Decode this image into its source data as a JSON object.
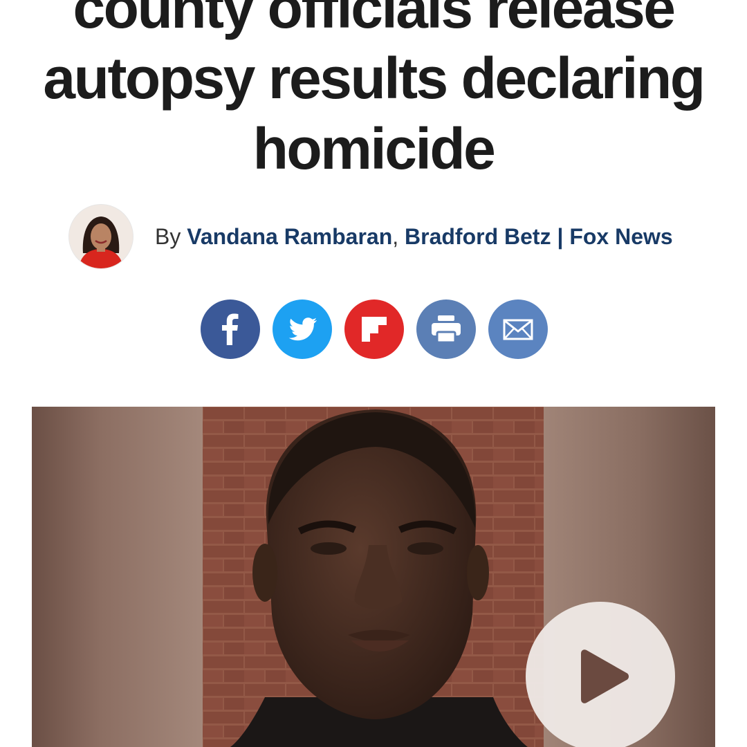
{
  "article": {
    "headline_lines": [
      "county officials release",
      "autopsy results declaring",
      "homicide"
    ]
  },
  "byline": {
    "prefix": "By",
    "author_1": "Vandana Rambaran",
    "separator": ",",
    "author_2": "Bradford Betz",
    "divider": "|",
    "publication": "Fox News"
  },
  "share_buttons": [
    {
      "name": "facebook",
      "icon": "facebook-icon",
      "color": "#3b5998"
    },
    {
      "name": "twitter",
      "icon": "twitter-bird-icon",
      "color": "#1da1f2"
    },
    {
      "name": "flipboard",
      "icon": "flipboard-icon",
      "color": "#e12828"
    },
    {
      "name": "print",
      "icon": "printer-icon",
      "color": "#5b7fb5"
    },
    {
      "name": "email",
      "icon": "envelope-icon",
      "color": "#5b84c0"
    }
  ],
  "media": {
    "play_icon": "play-icon",
    "play_color": "#6b4a40"
  }
}
